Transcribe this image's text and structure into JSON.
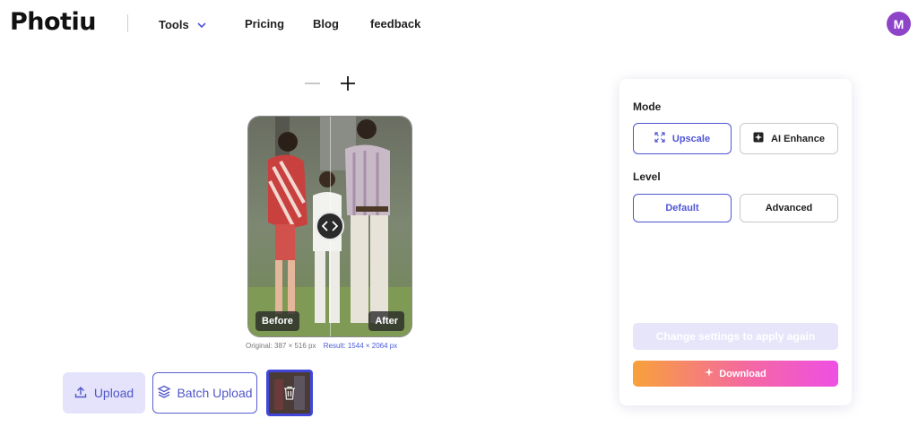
{
  "header": {
    "logo": "Photiu",
    "nav": {
      "tools": "Tools",
      "pricing": "Pricing",
      "blog": "Blog",
      "feedback": "feedback"
    },
    "avatar_initial": "M"
  },
  "viewer": {
    "before_label": "Before",
    "after_label": "After",
    "original_dims": "Original: 387 × 516 px",
    "result_dims": "Result: 1544 × 2064 px"
  },
  "actions": {
    "upload": "Upload",
    "batch_upload": "Batch Upload"
  },
  "panel": {
    "mode_label": "Mode",
    "mode_options": [
      "Upscale",
      "AI Enhance"
    ],
    "mode_selected": "Upscale",
    "level_label": "Level",
    "level_options": [
      "Default",
      "Advanced"
    ],
    "level_selected": "Default",
    "apply_label": "Change settings to apply again",
    "download_label": "Download"
  },
  "colors": {
    "accent": "#4f55d4",
    "avatar": "#8e44c9",
    "download_gradient": [
      "#f8a13b",
      "#f469a0",
      "#ee4fe4"
    ]
  },
  "icons": [
    "chevron-down-icon",
    "minus-icon",
    "plus-icon",
    "compare-handle-icon",
    "upload-icon",
    "layers-icon",
    "trash-icon",
    "expand-icon",
    "enhance-icon",
    "sparkle-icon"
  ]
}
